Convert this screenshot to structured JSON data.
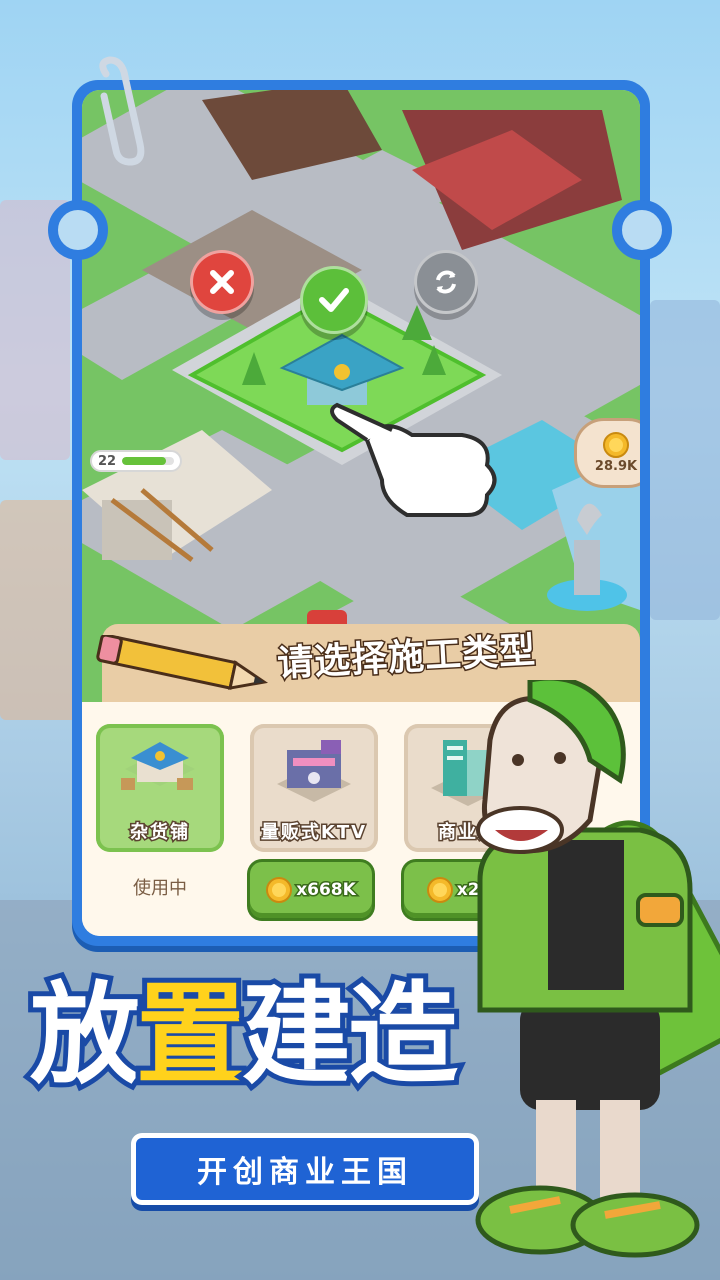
{
  "map": {
    "coin_bubble_value": "28.9K",
    "level_number": "22",
    "level_progress": 0.85,
    "prompt": "请选择施工类型"
  },
  "actions": {
    "cancel_icon": "close-icon",
    "confirm_icon": "check-icon",
    "rotate_icon": "rotate-icon"
  },
  "shop": {
    "items": [
      {
        "name": "杂货铺",
        "status": "使用中"
      },
      {
        "name": "量贩式KTV",
        "price": "x668K"
      },
      {
        "name": "商业大",
        "price": "x288"
      }
    ]
  },
  "headline": {
    "part1": "放",
    "part2": "置",
    "part3": "建",
    "part4": "造"
  },
  "subtitle": "开创商业王国",
  "colors": {
    "frame": "#2f7de0",
    "headline_stroke": "#1a4aa6",
    "accent_yellow": "#ffd21c",
    "button_green": "#7cc04a"
  }
}
